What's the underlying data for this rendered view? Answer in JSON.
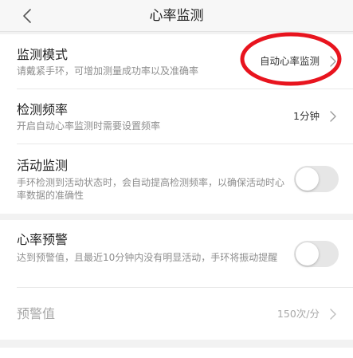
{
  "nav": {
    "title": "心率监测",
    "back_icon": "chevron-left-icon"
  },
  "settings": {
    "monitor_mode": {
      "title": "监测模式",
      "subtitle": "请戴紧手环，可增加测量成功率以及准确率",
      "value": "自动心率监测"
    },
    "detect_frequency": {
      "title": "检测频率",
      "subtitle": "开启自动心率监测时需要设置频率",
      "value": "1分钟"
    },
    "activity_monitor": {
      "title": "活动监测",
      "subtitle": "手环检测到活动状态时，会自动提高检测频率，以确保活动时心率数据的准确性",
      "enabled": false
    },
    "heart_rate_alert": {
      "title": "心率预警",
      "subtitle": "达到预警值，且最近10分钟内没有明显活动，手环将振动提醒",
      "enabled": false
    },
    "alert_value": {
      "title": "预警值",
      "value": "150次/分"
    }
  },
  "colors": {
    "annotation": "#e8141e",
    "toggle_off": "#e6e6e6",
    "background": "#f2f2f2"
  }
}
